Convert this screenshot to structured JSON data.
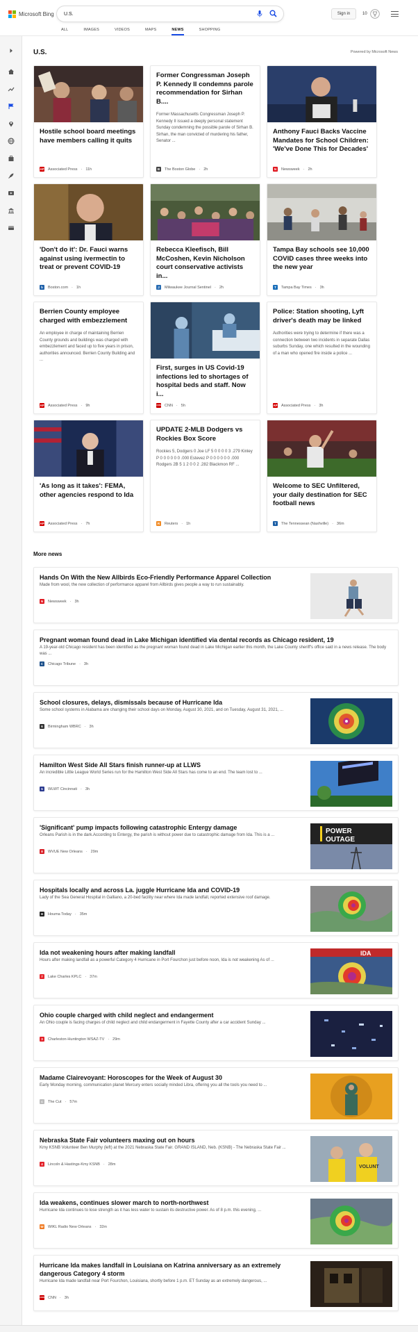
{
  "header": {
    "brand": "Microsoft Bing",
    "query": "U.S.",
    "sign_in": "Sign in",
    "rewards_count": "10",
    "tabs": [
      {
        "label": "ALL"
      },
      {
        "label": "IMAGES"
      },
      {
        "label": "VIDEOS"
      },
      {
        "label": "MAPS"
      },
      {
        "label": "NEWS"
      },
      {
        "label": "SHOPPING"
      }
    ]
  },
  "section": {
    "title": "U.S.",
    "powered_by": "Powered by Microsoft News"
  },
  "cards": [
    {
      "title": "Hostile school board meetings have members calling it quits",
      "snippet": "",
      "source": "Associated Press",
      "age": "11h",
      "logo_color": "#d40000",
      "logo_text": "AP"
    },
    {
      "title": "Former Congressman Joseph P. Kennedy II condemns parole recommendation for Sirhan B....",
      "snippet": "Former Massachusetts Congressman Joseph P. Kennedy II issued a deeply personal statement Sunday condemning the possible parole of Sirhan B. Sirhan, the man convicted of murdering his father, Senator ...",
      "source": "The Boston Globe",
      "age": "2h",
      "logo_color": "#444444",
      "logo_text": "B"
    },
    {
      "title": "Anthony Fauci Backs Vaccine Mandates for School Children: 'We've Done This for Decades'",
      "snippet": "",
      "source": "Newsweek",
      "age": "2h",
      "logo_color": "#e01a22",
      "logo_text": "N"
    },
    {
      "title": "'Don't do it': Dr. Fauci warns against using ivermectin to treat or prevent COVID-19",
      "snippet": "",
      "source": "Boston.com",
      "age": "1h",
      "logo_color": "#1d5fa8",
      "logo_text": "b"
    },
    {
      "title": "Rebecca Kleefisch, Bill McCoshen, Kevin Nicholson court conservative activists in...",
      "snippet": "",
      "source": "Milwaukee Journal Sentinel",
      "age": "2h",
      "logo_color": "#2a6db3",
      "logo_text": "J"
    },
    {
      "title": "Tampa Bay schools see 10,000 COVID cases three weeks into the new year",
      "snippet": "",
      "source": "Tampa Bay Times",
      "age": "3h",
      "logo_color": "#1c6fb9",
      "logo_text": "T"
    },
    {
      "title": "Berrien County employee charged with embezzlement",
      "snippet": "An employee in charge of maintaining Berrien County grounds and buildings was charged with embezzlement and faced up to five years in prison, authorities announced. Berrien County Building and ...",
      "source": "Associated Press",
      "age": "9h",
      "logo_color": "#d40000",
      "logo_text": "AP"
    },
    {
      "title": "First, surges in US Covid-19 infections led to shortages of hospital beds and staff. Now i...",
      "snippet": "",
      "source": "CNN",
      "age": "5h",
      "logo_color": "#cc0000",
      "logo_text": "CNN"
    },
    {
      "title": "Police: Station shooting, Lyft driver's death may be linked",
      "snippet": "Authorities were trying to determine if there was a connection between two incidents in separate Dallas suburbs Sunday, one which resulted in the wounding of a man who opened fire inside a police ...",
      "source": "Associated Press",
      "age": "3h",
      "logo_color": "#d40000",
      "logo_text": "AP"
    },
    {
      "title": "'As long as it takes': FEMA, other agencies respond to Ida",
      "snippet": "",
      "source": "Associated Press",
      "age": "7h",
      "logo_color": "#d40000",
      "logo_text": "AP"
    },
    {
      "title": "UPDATE 2-MLB Dodgers vs Rockies Box Score",
      "snippet": "Rockies 5, Dodgers 0 Joe LF 5 0 0 0 0 3 .279 Kinley P 0 0 0 0 0 0 .000 Estevez P 0 0 0 0 0 0 .000 Rodgers 2B 5 1 2 0 0 2 .282 Blackmon RF ...",
      "source": "Reuters",
      "age": "1h",
      "logo_color": "#f08a24",
      "logo_text": "R"
    },
    {
      "title": "Welcome to SEC Unfiltered, your daily destination for SEC football news",
      "snippet": "",
      "source": "The Tennessean (Nashville)",
      "age": "36m",
      "logo_color": "#1b5ea5",
      "logo_text": "T"
    }
  ],
  "more_news": {
    "title": "More news",
    "items": [
      {
        "title": "Hands On With the New Allbirds Eco-Friendly Performance Apparel Collection",
        "snippet": "Made from wool, the new collection of performance apparel from Allbirds gives people a way to run sustainably.",
        "source": "Newsweek",
        "age": "3h",
        "logo_color": "#e01a22",
        "logo_text": "N",
        "thumb": "runner"
      },
      {
        "title": "Pregnant woman found dead in Lake Michigan identified via dental records as Chicago resident, 19",
        "snippet": "A 19-year-old Chicago resident has been identified as the pregnant woman found dead in Lake Michigan earlier this month, the Lake County sheriff's office said in a news release. The body was ...",
        "source": "Chicago Tribune",
        "age": "3h",
        "logo_color": "#1a4f8a",
        "logo_text": "C",
        "thumb": ""
      },
      {
        "title": "School closures, delays, dismissals because of Hurricane Ida",
        "snippet": "Some school systems in Alabama are changing their school days on Monday, August 30, 2021, and on Tuesday, August 31, 2021, ...",
        "source": "Birmingham WBRC",
        "age": "3h",
        "logo_color": "#333333",
        "logo_text": "6",
        "thumb": "hurricane"
      },
      {
        "title": "Hamilton West Side All Stars finish runner-up at LLWS",
        "snippet": "An incredible Little League World Series run for the Hamilton West Side All Stars has come to an end. The team lost to ...",
        "source": "WLWT Cincinnati",
        "age": "3h",
        "logo_color": "#2b3a8f",
        "logo_text": "5",
        "thumb": "scoreboard"
      },
      {
        "title": "'Significant' pump impacts following catastrophic Entergy damage",
        "snippet": "Orleans Parish is in the dark.According to Entergy, the parish is without power due to catastrophic damage from Ida. This is a ...",
        "source": "WVUE New Orleans",
        "age": "29m",
        "logo_color": "#d81f26",
        "logo_text": "8",
        "thumb": "outage"
      },
      {
        "title": "Hospitals locally and across La. juggle Hurricane Ida and COVID-19",
        "snippet": "Lady of the Sea General Hospital in Galliano, a 20-bed facility near where Ida made landfall, reported extensive roof damage.",
        "source": "Houma Today",
        "age": "35m",
        "logo_color": "#222222",
        "logo_text": "H",
        "thumb": "radar"
      },
      {
        "title": "Ida not weakening hours after making landfall",
        "snippet": "Hours after making landfall as a powerful Category 4 Hurricane in Port Fourchon just before noon, Ida is not weakening As of ...",
        "source": "Lake Charles KPLC",
        "age": "37m",
        "logo_color": "#e5272d",
        "logo_text": "7",
        "thumb": "ida"
      },
      {
        "title": "Ohio couple charged with child neglect and endangerment",
        "snippet": "An Ohio couple is facing charges of child neglect and child endangerment in Fayette County after a car accident Sunday ...",
        "source": "Charleston-Huntington WSAZ-TV",
        "age": "29m",
        "logo_color": "#e2222a",
        "logo_text": "3",
        "thumb": "glass"
      },
      {
        "title": "Madame Clairevoyant: Horoscopes for the Week of August 30",
        "snippet": "Early Monday morning, communication planet Mercury enters socially minded Libra, offering you all the tools you need to ...",
        "source": "The Cut",
        "age": "57m",
        "logo_color": "#bbbbbb",
        "logo_text": "c",
        "thumb": "horoscope"
      },
      {
        "title": "Nebraska State Fair volunteers maxing out on hours",
        "snippet": "Kmy KSNB Volunteer Ben Murphy (left) at the 2021 Nebraska State Fair. GRAND ISLAND, Neb. (KSNB) - The Nebraska State Fair ...",
        "source": "Lincoln & Hastings-Kmy KSNB",
        "age": "28m",
        "logo_color": "#e2222a",
        "logo_text": "4",
        "thumb": "volunteers"
      },
      {
        "title": "Ida weakens, continues slower march to north-northwest",
        "snippet": "Hurricane Ida continues to lose strength as it has less water to sustain its destructive power. As of 8 p.m. this evening, ...",
        "source": "WIKL Radio New Orleans",
        "age": "32m",
        "logo_color": "#f07a22",
        "logo_text": "W",
        "thumb": "radar2"
      },
      {
        "title": "Hurricane Ida makes landfall in Louisiana on Katrina anniversary as an extremely dangerous Category 4 storm",
        "snippet": "Hurricane Ida made landfall near Port Fourchon, Louisiana, shortly before 1 p.m. ET Sunday as an extremely dangerous, ...",
        "source": "CNN",
        "age": "3h",
        "logo_color": "#cc0000",
        "logo_text": "CNN",
        "thumb": "storm"
      }
    ]
  }
}
